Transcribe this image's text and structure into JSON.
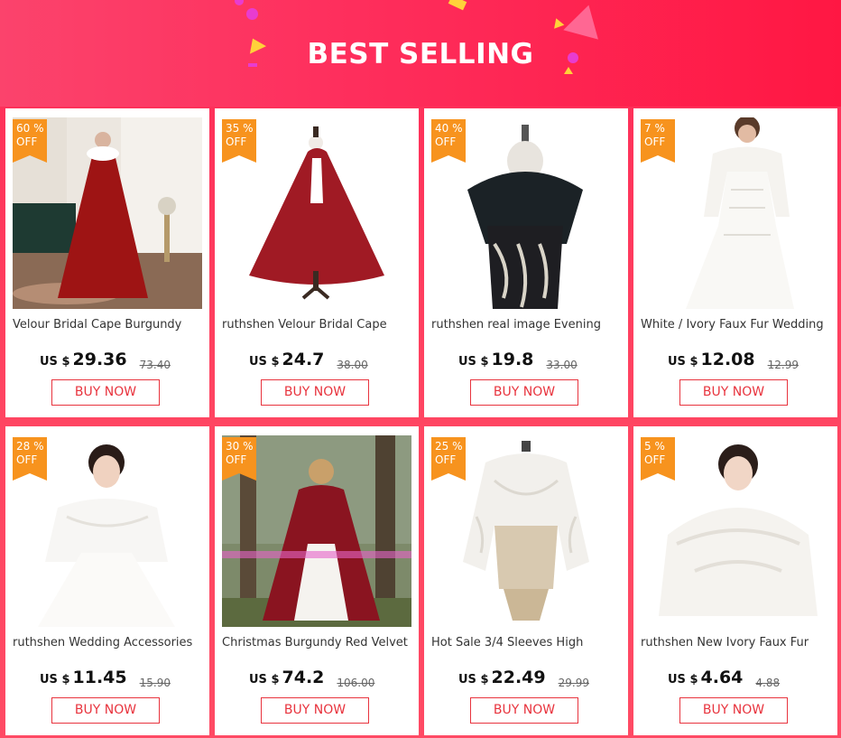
{
  "banner": {
    "title": "BEST SELLING"
  },
  "colors": {
    "accent": "#e8343e",
    "badge": "#f7931e",
    "background": "#fe2a57"
  },
  "products": [
    {
      "title": "Velour Bridal Cape Burgundy",
      "discount": "60 %",
      "off": "OFF",
      "currency": "US $",
      "price": "29.36",
      "old_price": "73.40",
      "buy": "BUY NOW"
    },
    {
      "title": "ruthshen Velour Bridal Cape",
      "discount": "35 %",
      "off": "OFF",
      "currency": "US $",
      "price": "24.7",
      "old_price": "38.00",
      "buy": "BUY NOW"
    },
    {
      "title": "ruthshen real image Evening",
      "discount": "40 %",
      "off": "OFF",
      "currency": "US $",
      "price": "19.8",
      "old_price": "33.00",
      "buy": "BUY NOW"
    },
    {
      "title": "White / Ivory Faux Fur Wedding",
      "discount": "7  %",
      "off": "OFF",
      "currency": "US $",
      "price": "12.08",
      "old_price": "12.99",
      "buy": "BUY NOW"
    },
    {
      "title": "ruthshen Wedding Accessories",
      "discount": "28 %",
      "off": "OFF",
      "currency": "US $",
      "price": "11.45",
      "old_price": "15.90",
      "buy": "BUY NOW"
    },
    {
      "title": "Christmas Burgundy Red Velvet",
      "discount": "30 %",
      "off": "OFF",
      "currency": "US $",
      "price": "74.2",
      "old_price": "106.00",
      "buy": "BUY NOW"
    },
    {
      "title": "Hot Sale 3/4 Sleeves High",
      "discount": "25 %",
      "off": "OFF",
      "currency": "US $",
      "price": "22.49",
      "old_price": "29.99",
      "buy": "BUY NOW"
    },
    {
      "title": "ruthshen New Ivory Faux Fur",
      "discount": "5  %",
      "off": "OFF",
      "currency": "US $",
      "price": "4.64",
      "old_price": "4.88",
      "buy": "BUY NOW"
    }
  ]
}
